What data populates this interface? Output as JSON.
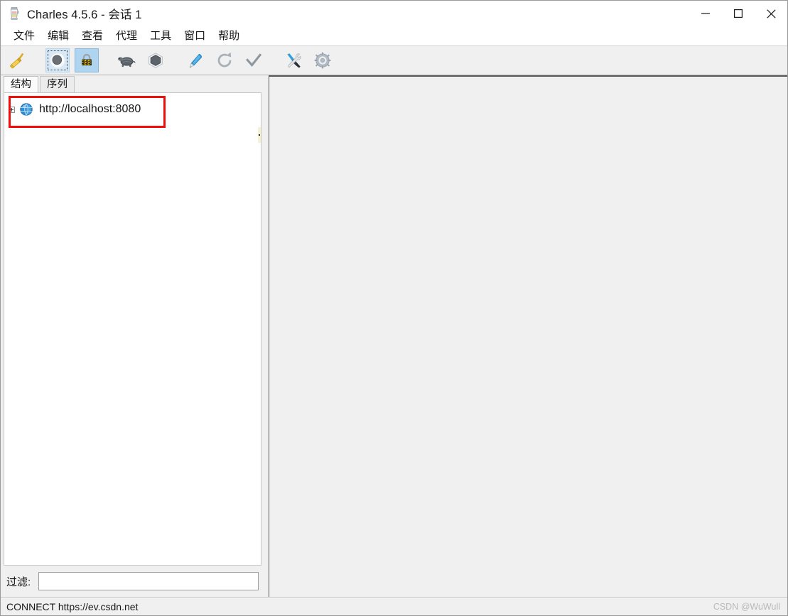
{
  "window": {
    "title": "Charles 4.5.6 - 会话 1",
    "app_icon": "charles-jug-icon",
    "controls": {
      "minimize": "minimize-icon",
      "maximize": "maximize-icon",
      "close": "close-icon"
    }
  },
  "menu": {
    "items": [
      {
        "label": "文件",
        "name": "menu-file"
      },
      {
        "label": "编辑",
        "name": "menu-edit"
      },
      {
        "label": "查看",
        "name": "menu-view"
      },
      {
        "label": "代理",
        "name": "menu-proxy"
      },
      {
        "label": "工具",
        "name": "menu-tools"
      },
      {
        "label": "窗口",
        "name": "menu-window"
      },
      {
        "label": "帮助",
        "name": "menu-help"
      }
    ]
  },
  "toolbar": {
    "buttons": [
      {
        "icon": "broom-icon",
        "state": "normal"
      },
      {
        "icon": "record-circle-icon",
        "state": "selected-focus"
      },
      {
        "icon": "ssl-padlock-icon",
        "state": "selected"
      },
      {
        "icon": "turtle-throttle-icon",
        "state": "normal"
      },
      {
        "icon": "hexagon-breakpoint-icon",
        "state": "normal"
      },
      {
        "icon": "pen-compose-icon",
        "state": "normal"
      },
      {
        "icon": "reload-icon",
        "state": "normal"
      },
      {
        "icon": "checkmark-validate-icon",
        "state": "normal"
      },
      {
        "icon": "tools-wrench-screwdriver-icon",
        "state": "normal"
      },
      {
        "icon": "gear-settings-icon",
        "state": "normal"
      }
    ]
  },
  "tabs": [
    {
      "label": "结构",
      "name": "tab-structure",
      "active": true
    },
    {
      "label": "序列",
      "name": "tab-sequence",
      "active": false
    }
  ],
  "tree": {
    "items": [
      {
        "label": "http://localhost:8080",
        "icon": "globe-icon",
        "expander": "plus-box-icon",
        "expanded": false
      }
    ]
  },
  "filter": {
    "label": "过滤:",
    "value": "",
    "placeholder": ""
  },
  "status": {
    "text": "CONNECT https://ev.csdn.net"
  },
  "watermark": {
    "text": "CSDN @WuWull"
  },
  "annotation": {
    "color": "#f20d0d",
    "target": "http://localhost:8080"
  },
  "colors": {
    "window_bg": "#f0f0f0",
    "panel_white": "#ffffff",
    "toolbar_selected": "#aed4f0",
    "toolbar_focus": "#d7e8f7",
    "annotation_red": "#f20d0d",
    "splitter": "#5a5a5a",
    "watermark_grey": "#b9b9b9"
  }
}
